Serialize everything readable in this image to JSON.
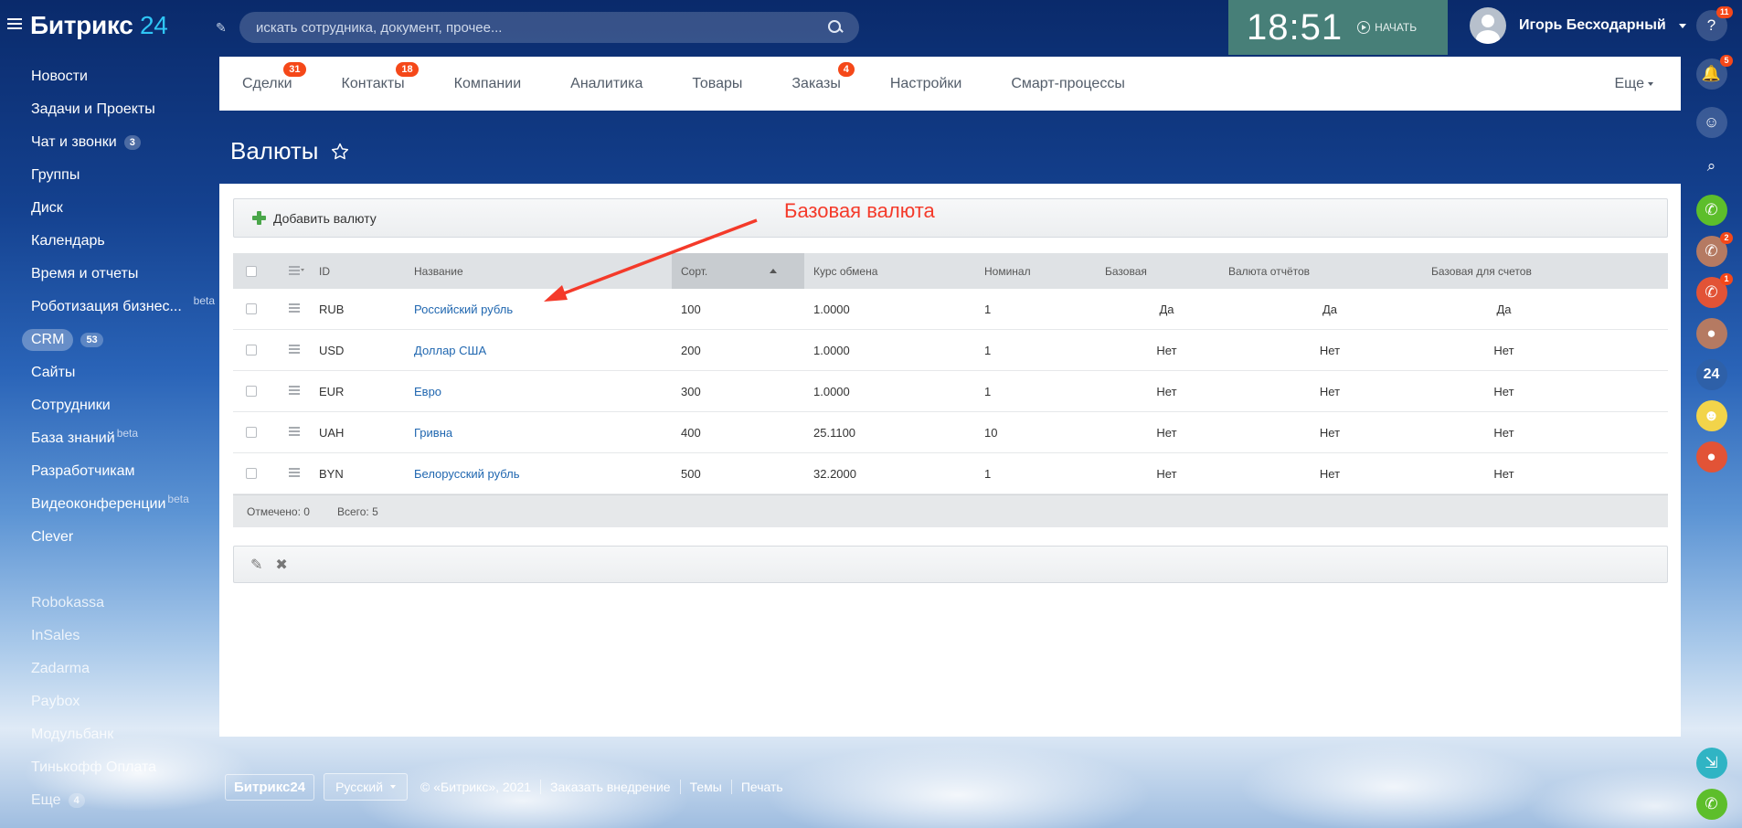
{
  "header": {
    "logo_main": "Битрикс",
    "logo_num": "24",
    "search_placeholder": "искать сотрудника, документ, прочее...",
    "clock": "18:51",
    "start_label": "НАЧАТЬ",
    "user_name": "Игорь Бесходарный"
  },
  "left_menu": {
    "items": [
      {
        "label": "Новости"
      },
      {
        "label": "Задачи и Проекты"
      },
      {
        "label": "Чат и звонки",
        "count": "3"
      },
      {
        "label": "Группы"
      },
      {
        "label": "Диск"
      },
      {
        "label": "Календарь"
      },
      {
        "label": "Время и отчеты"
      },
      {
        "label": "Роботизация бизнес...",
        "beta": "beta"
      },
      {
        "label": "CRM",
        "count": "53"
      },
      {
        "label": "Сайты"
      },
      {
        "label": "Сотрудники"
      },
      {
        "label": "База знаний",
        "beta": "beta"
      },
      {
        "label": "Разработчикам"
      },
      {
        "label": "Видеоконференции",
        "beta": "beta"
      },
      {
        "label": "Clever"
      }
    ],
    "apps": [
      {
        "label": "Robokassa"
      },
      {
        "label": "InSales"
      },
      {
        "label": "Zadarma"
      },
      {
        "label": "Paybox"
      },
      {
        "label": "Модульбанк"
      },
      {
        "label": "Тинькофф Оплата"
      },
      {
        "label": "Еще",
        "count": "4"
      }
    ]
  },
  "tabs": [
    {
      "label": "Сделки",
      "badge": "31"
    },
    {
      "label": "Контакты",
      "badge": "18"
    },
    {
      "label": "Компании"
    },
    {
      "label": "Аналитика"
    },
    {
      "label": "Товары"
    },
    {
      "label": "Заказы",
      "badge": "4"
    },
    {
      "label": "Настройки"
    },
    {
      "label": "Смарт-процессы"
    }
  ],
  "tabs_more": "Еще",
  "page_title": "Валюты",
  "add_button": "Добавить валюту",
  "annotation": "Базовая валюта",
  "grid": {
    "columns": {
      "id": "ID",
      "name": "Название",
      "sort": "Сорт.",
      "rate": "Курс обмена",
      "nominal": "Номинал",
      "base": "Базовая",
      "report": "Валюта отчётов",
      "accounts": "Базовая для счетов"
    },
    "rows": [
      {
        "id": "RUB",
        "name": "Российский рубль",
        "sort": "100",
        "rate": "1.0000",
        "nominal": "1",
        "base": "Да",
        "report": "Да",
        "accounts": "Да"
      },
      {
        "id": "USD",
        "name": "Доллар США",
        "sort": "200",
        "rate": "1.0000",
        "nominal": "1",
        "base": "Нет",
        "report": "Нет",
        "accounts": "Нет"
      },
      {
        "id": "EUR",
        "name": "Евро",
        "sort": "300",
        "rate": "1.0000",
        "nominal": "1",
        "base": "Нет",
        "report": "Нет",
        "accounts": "Нет"
      },
      {
        "id": "UAH",
        "name": "Гривна",
        "sort": "400",
        "rate": "25.1100",
        "nominal": "10",
        "base": "Нет",
        "report": "Нет",
        "accounts": "Нет"
      },
      {
        "id": "BYN",
        "name": "Белорусский рубль",
        "sort": "500",
        "rate": "32.2000",
        "nominal": "1",
        "base": "Нет",
        "report": "Нет",
        "accounts": "Нет"
      }
    ],
    "footer_selected": "Отмечено: 0",
    "footer_total": "Всего: 5"
  },
  "footer": {
    "logo": "Битрикс24",
    "lang": "Русский",
    "copyright": "© «Битрикс», 2021",
    "order": "Заказать внедрение",
    "themes": "Темы",
    "print": "Печать"
  },
  "right_bar": {
    "help_badge": "11",
    "notif_badge": "5",
    "call1_badge": "2",
    "call2_badge": "1",
    "b24_label": "24"
  },
  "colors": {
    "accent": "#2fc6f6",
    "badge": "#f54819",
    "link": "#2067b0",
    "clock_bg": "#477f78",
    "annotation": "#f43a2a"
  }
}
